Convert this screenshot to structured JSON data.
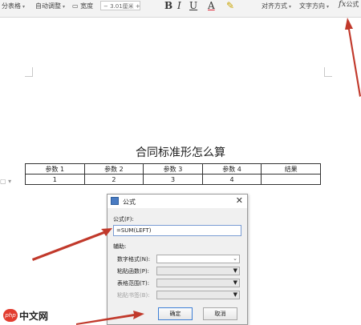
{
  "ribbon": {
    "table_style_label": "分表格",
    "auto_adjust_label": "自动调整",
    "width_label": "宽度",
    "width_value": "3.01厘米",
    "bold": "B",
    "italic": "I",
    "underline": "U",
    "font_color": "A",
    "highlight": "✎",
    "align_label": "对齐方式",
    "text_direction_label": "文字方向",
    "formula_icon": "fx",
    "formula_label": "公式"
  },
  "document": {
    "title": "合同标准形怎么算",
    "table": {
      "headers": [
        "参数 1",
        "参数 2",
        "参数 3",
        "参数 4",
        "结果"
      ],
      "rows": [
        [
          "1",
          "2",
          "3",
          "4",
          ""
        ]
      ]
    },
    "handle": "▢ ▾"
  },
  "dialog": {
    "title": "公式",
    "close": "✕",
    "formula_label": "公式(F):",
    "formula_value": "=SUM(LEFT)",
    "aux_label": "辅助:",
    "number_format_label": "数字格式(N):",
    "paste_function_label": "粘贴函数(P):",
    "table_range_label": "表格范围(T):",
    "bookmark_label": "粘贴书签(B):",
    "ok_label": "确定",
    "cancel_label": "取消"
  },
  "watermark": {
    "logo": "php",
    "text": "中文网"
  },
  "colors": {
    "arrow": "#c1392b",
    "accent": "#3d7fd6"
  }
}
